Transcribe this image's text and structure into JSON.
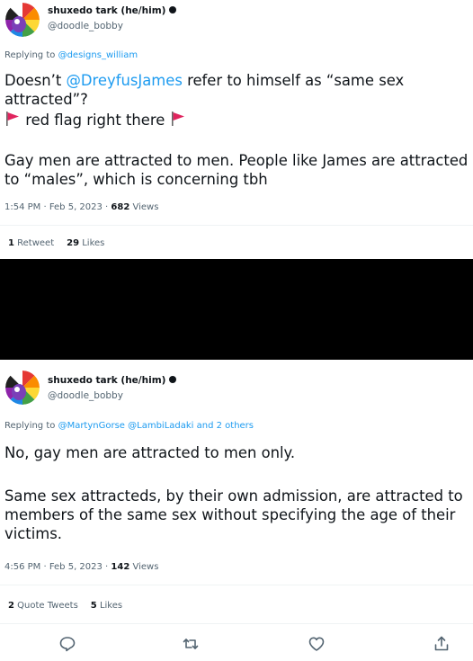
{
  "tweets": [
    {
      "author_name": "shuxedo tark (he/him)",
      "author_handle": "@doodle_bobby",
      "replying_prefix": "Replying to ",
      "replying_to": "@designs_william",
      "line1_pre": "Doesn’t ",
      "line1_mention": "@DreyfusJames",
      "line1_post": " refer to himself as “same sex attracted”?",
      "line2_text": " red flag right there ",
      "line3_text": "Gay men are attracted to men. People like James are attracted to “males”, which is concerning tbh",
      "time": "1:54 PM · Feb 5, 2023 · ",
      "views_count": "682",
      "views_label": " Views",
      "stat1_count": "1",
      "stat1_label": " Retweet",
      "stat2_count": "29",
      "stat2_label": " Likes"
    },
    {
      "author_name": "shuxedo tark (he/him)",
      "author_handle": "@doodle_bobby",
      "replying_prefix": "Replying to ",
      "replying_to": "@MartynGorse @LambiLadaki and 2 others",
      "line1_text": "No, gay men are attracted to men only.",
      "line2_text": "Same sex attracteds, by their own admission, are attracted to members of the same sex without specifying the age of their victims.",
      "time": "4:56 PM · Feb 5, 2023 · ",
      "views_count": "142",
      "views_label": " Views",
      "stat1_count": "2",
      "stat1_label": " Quote Tweets",
      "stat2_count": "5",
      "stat2_label": " Likes"
    }
  ],
  "actions": [
    "reply-icon",
    "retweet-icon",
    "like-icon",
    "share-icon"
  ],
  "colors": {
    "link": "#1d9bf0",
    "secondary": "#536471",
    "flag": "#e0245e",
    "redacted": "#000000"
  }
}
